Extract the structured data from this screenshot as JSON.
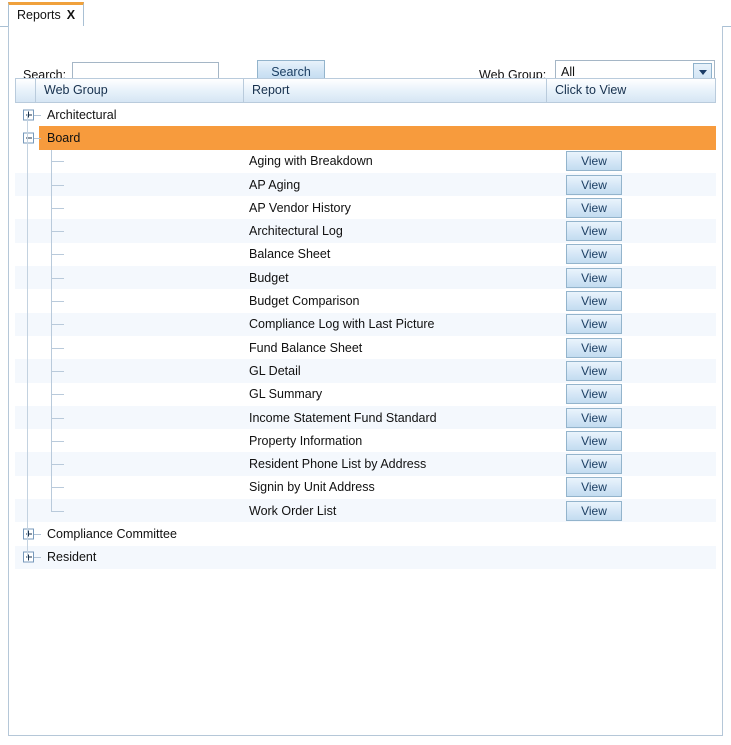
{
  "tab": {
    "label": "Reports",
    "close": "X"
  },
  "toolbar": {
    "search_label": "Search:",
    "search_value": "",
    "search_placeholder": "",
    "search_button": "Search",
    "web_group_label": "Web Group:",
    "web_group_value": "All",
    "web_group_options": [
      "All"
    ]
  },
  "grid": {
    "columns": [
      "",
      "Web Group",
      "Report",
      "Click to View"
    ],
    "view_button_label": "View",
    "rows": [
      {
        "type": "group",
        "label": "Architectural",
        "expanded": false,
        "selected": false,
        "zebra": "white"
      },
      {
        "type": "group",
        "label": "Board",
        "expanded": true,
        "selected": true,
        "zebra": "white"
      },
      {
        "type": "report",
        "label": "Aging with Breakdown",
        "zebra": "white"
      },
      {
        "type": "report",
        "label": "AP Aging",
        "zebra": "alt"
      },
      {
        "type": "report",
        "label": "AP Vendor History",
        "zebra": "white"
      },
      {
        "type": "report",
        "label": "Architectural Log",
        "zebra": "alt"
      },
      {
        "type": "report",
        "label": "Balance Sheet",
        "zebra": "white"
      },
      {
        "type": "report",
        "label": "Budget",
        "zebra": "alt"
      },
      {
        "type": "report",
        "label": "Budget Comparison",
        "zebra": "white"
      },
      {
        "type": "report",
        "label": "Compliance Log with Last Picture",
        "zebra": "alt"
      },
      {
        "type": "report",
        "label": "Fund Balance Sheet",
        "zebra": "white"
      },
      {
        "type": "report",
        "label": "GL Detail",
        "zebra": "alt"
      },
      {
        "type": "report",
        "label": "GL Summary",
        "zebra": "white"
      },
      {
        "type": "report",
        "label": "Income Statement Fund Standard",
        "zebra": "alt"
      },
      {
        "type": "report",
        "label": "Property Information",
        "zebra": "white"
      },
      {
        "type": "report",
        "label": "Resident Phone List by Address",
        "zebra": "alt"
      },
      {
        "type": "report",
        "label": "Signin by Unit Address",
        "zebra": "white"
      },
      {
        "type": "report",
        "label": "Work Order List",
        "zebra": "alt"
      },
      {
        "type": "group",
        "label": "Compliance Committee",
        "expanded": false,
        "selected": false,
        "zebra": "white"
      },
      {
        "type": "group",
        "label": "Resident",
        "expanded": false,
        "selected": false,
        "zebra": "alt"
      }
    ]
  },
  "colors": {
    "selected_row": "#f79b3d",
    "tab_accent": "#f0a13c",
    "header_border": "#b9cbdc",
    "zebra": "#f4f8fd"
  }
}
